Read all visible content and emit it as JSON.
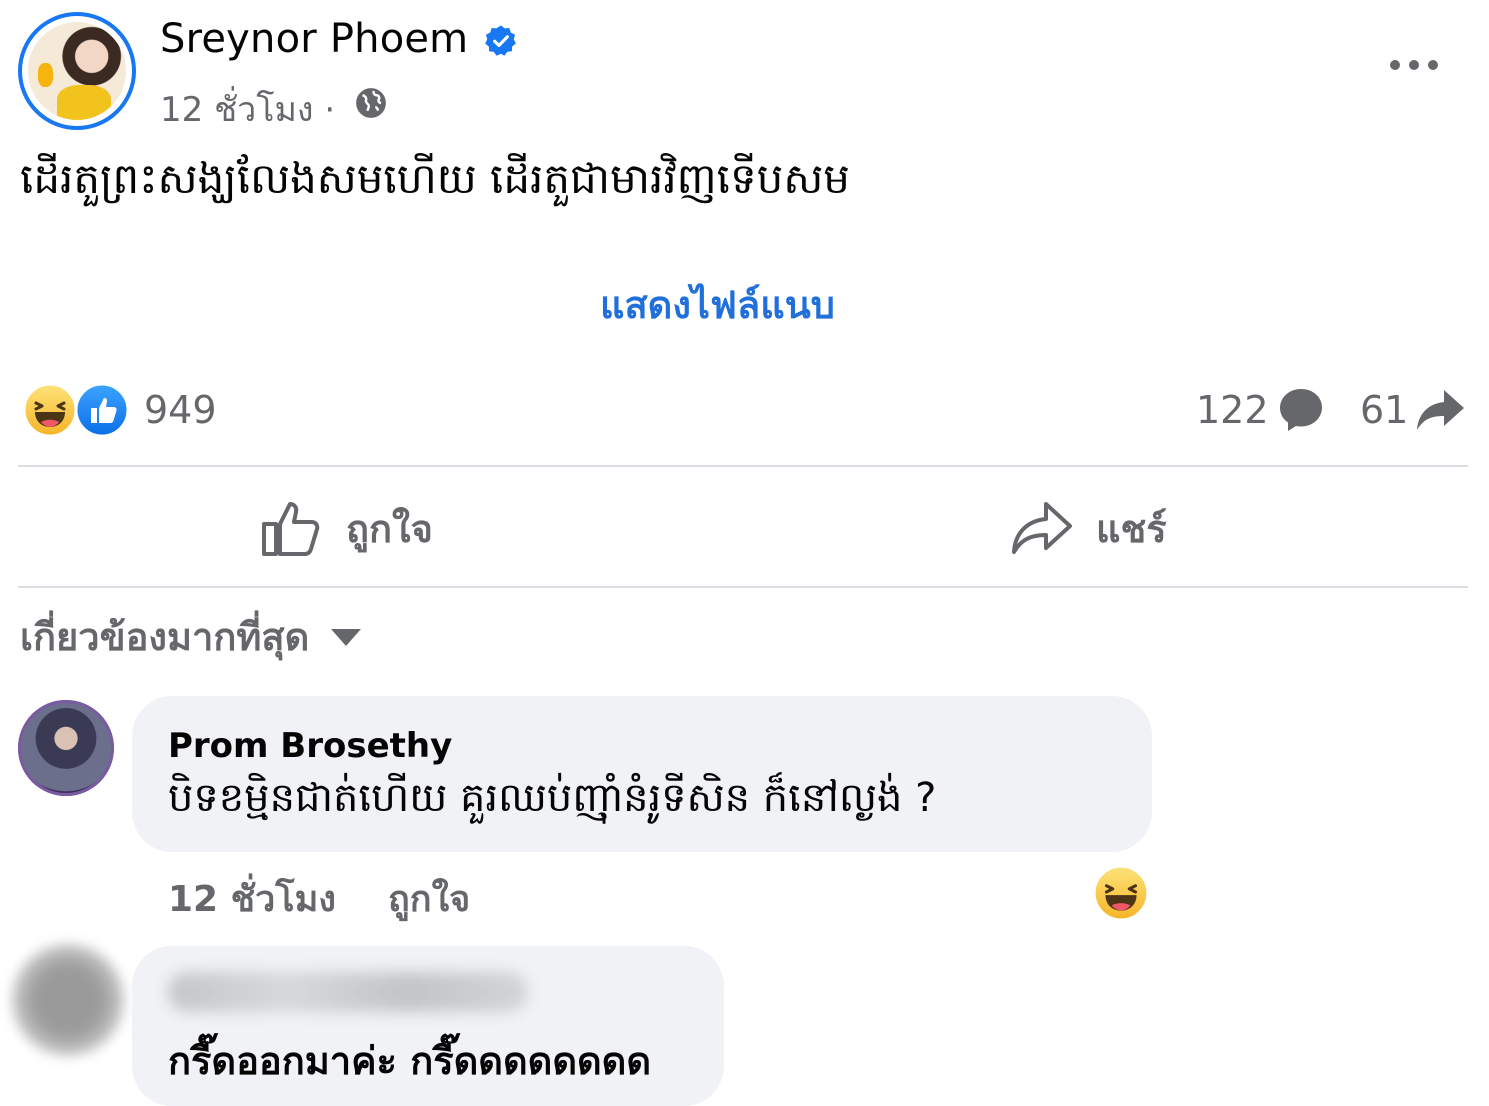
{
  "post": {
    "author": "Sreynor Phoem",
    "time": "12 ชั่วโมง ·",
    "text": "ដើរតួព្រះសង្ឃលែងសមហើយ ដើរតួជាមារវិញទើបសម",
    "see_attachment": "แสดงไฟล์แนบ"
  },
  "stats": {
    "reactions": "949",
    "comments": "122",
    "shares": "61"
  },
  "actions": {
    "like": "ถูกใจ",
    "share": "แชร์"
  },
  "sort": {
    "label": "เกี่ยวข้องมากที่สุด"
  },
  "comments": [
    {
      "name": "Prom Brosethy",
      "text": "បិទខម្មិនជាត់ហើយ គួរឈប់ញ៉ាំនំរូទីសិន ក៏នៅល្ងង់ ?",
      "time": "12 ชั่วโมง",
      "like": "ถูกใจ"
    },
    {
      "text": "กรี๊ดออกมาค่ะ กรี๊ดดดดดดดด"
    }
  ],
  "colors": {
    "accent": "#216fdb",
    "secondary_text": "#65676b",
    "bubble": "#f0f2f5",
    "divider": "#dadde1"
  }
}
